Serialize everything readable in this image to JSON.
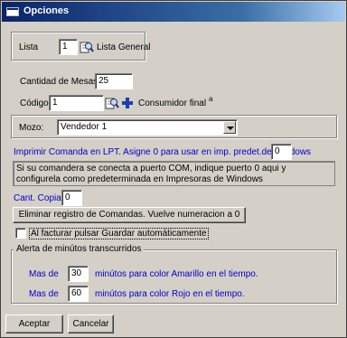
{
  "window": {
    "title": "Opciones"
  },
  "lista": {
    "label": "Lista",
    "value": "1",
    "name": "Lista General"
  },
  "mesas": {
    "label": "Cantidad de Mesas:",
    "value": "25"
  },
  "codigo": {
    "label": "Código:",
    "value": "1",
    "name": "Consumidor final",
    "marker": "a"
  },
  "mozo": {
    "label": "Mozo:",
    "selected": "Vendedor 1"
  },
  "comanda": {
    "label": "Imprimir Comanda en LPT. Asigne 0 para usar en imp. predet.de Windows",
    "value": "0",
    "info": "Si su comandera se conecta a puerto COM, indique puerto 0 aqui y configurela como predeterminada en Impresoras de Windows"
  },
  "copias": {
    "label": "Cant. Copias",
    "value": "0"
  },
  "eliminar_button": "Eliminar registro de Comandas. Vuelve numeracion a 0",
  "guardar_check": {
    "label": "Al facturar pulsar Guardar automáticamente",
    "checked": false
  },
  "alerta": {
    "legend": "Alerta de minútos transcurridos",
    "amarillo": {
      "prefix": "Mas de",
      "value": "30",
      "suffix": "minútos para color Amarillo en el tiempo."
    },
    "rojo": {
      "prefix": "Mas de",
      "value": "60",
      "suffix": "minútos para color Rojo en el tiempo."
    }
  },
  "buttons": {
    "accept": "Aceptar",
    "cancel": "Cancelar"
  },
  "colors": {
    "titlebar": "#0a246a",
    "face": "#d4d0c8",
    "link_text": "#0000cc"
  }
}
